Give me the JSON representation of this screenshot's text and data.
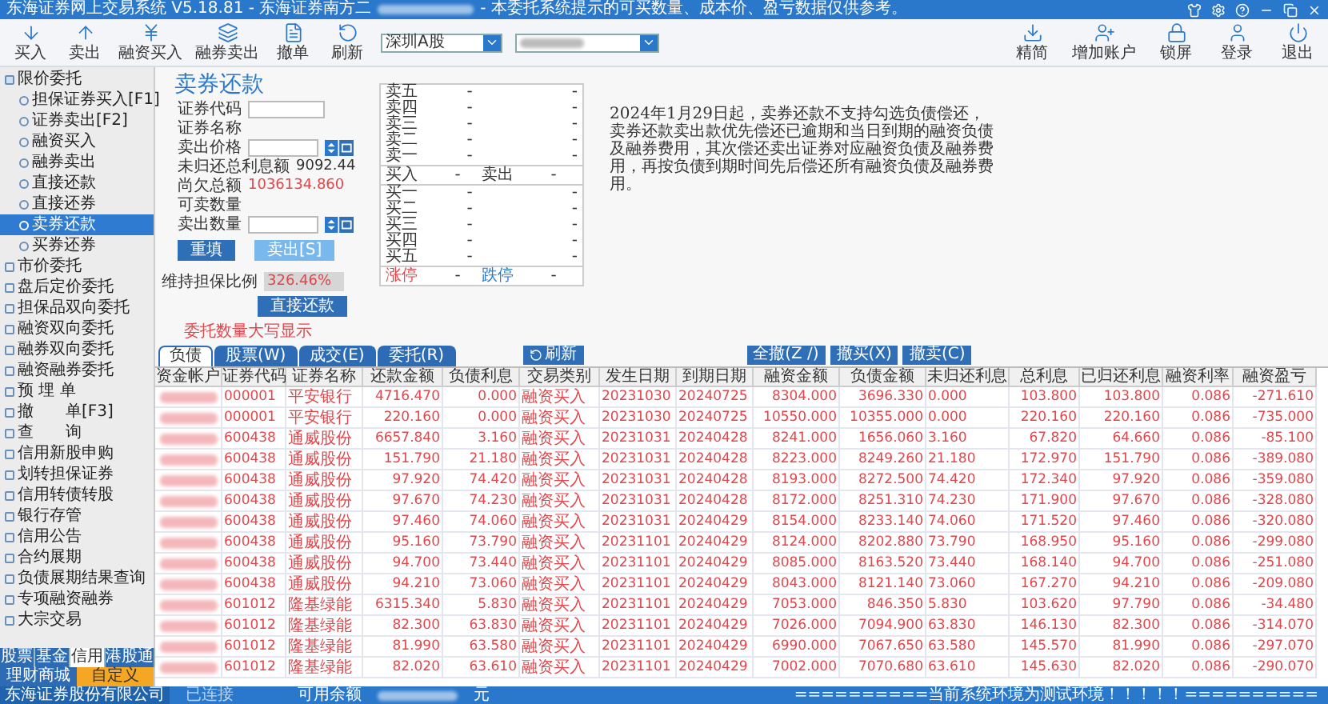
{
  "window": {
    "title": "东海证券网上交易系统 V5.18.81 - 东海证券南方二",
    "notice": " - 本委托系统提示的可买数量、成本价、盈亏数据仅供参考。"
  },
  "toolbar": {
    "buttons": [
      {
        "label": "买入",
        "kind": "buy"
      },
      {
        "label": "卖出",
        "kind": "sell"
      },
      {
        "label": "融资买入",
        "kind": "margin-buy"
      },
      {
        "label": "融券卖出",
        "kind": "short-sell"
      },
      {
        "label": "撤单",
        "kind": "cancel"
      },
      {
        "label": "刷新",
        "kind": "refresh"
      }
    ],
    "market_select": "深圳A股",
    "right_buttons": [
      {
        "label": "精简",
        "kind": "compact"
      },
      {
        "label": "增加账户",
        "kind": "add-account"
      },
      {
        "label": "锁屏",
        "kind": "lock"
      },
      {
        "label": "登录",
        "kind": "login"
      },
      {
        "label": "退出",
        "kind": "exit"
      }
    ]
  },
  "sidebar": {
    "items": [
      {
        "label": "限价委托",
        "selected": false,
        "expanded": true,
        "children": [
          {
            "label": "担保证券买入[F1]",
            "selected": false
          },
          {
            "label": "证券卖出[F2]",
            "selected": false
          },
          {
            "label": "融资买入",
            "selected": false
          },
          {
            "label": "融券卖出",
            "selected": false
          },
          {
            "label": "直接还款",
            "selected": false
          },
          {
            "label": "直接还券",
            "selected": false
          },
          {
            "label": "卖券还款",
            "selected": true
          },
          {
            "label": "买券还券",
            "selected": false
          }
        ]
      },
      {
        "label": "市价委托",
        "selected": false
      },
      {
        "label": "盘后定价委托",
        "selected": false
      },
      {
        "label": "担保品双向委托",
        "selected": false
      },
      {
        "label": "融资双向委托",
        "selected": false
      },
      {
        "label": "融券双向委托",
        "selected": false
      },
      {
        "label": "融资融券委托",
        "selected": false
      },
      {
        "label": "预 埋 单",
        "selected": false
      },
      {
        "label": "撤　　单[F3]",
        "selected": false
      },
      {
        "label": "查　　询",
        "selected": false
      },
      {
        "label": "信用新股申购",
        "selected": false
      },
      {
        "label": "划转担保证券",
        "selected": false
      },
      {
        "label": "信用转债转股",
        "selected": false
      },
      {
        "label": "银行存管",
        "selected": false
      },
      {
        "label": "信用公告",
        "selected": false
      },
      {
        "label": "合约展期",
        "selected": false
      },
      {
        "label": "负债展期结果查询",
        "selected": false
      },
      {
        "label": "专项融资融券",
        "selected": false
      },
      {
        "label": "大宗交易",
        "selected": false
      }
    ],
    "tabs": [
      {
        "label": "股票",
        "selected": false
      },
      {
        "label": "基金",
        "selected": false
      },
      {
        "label": "信用",
        "selected": true
      },
      {
        "label": "港股通",
        "selected": false
      }
    ],
    "links": [
      {
        "label": "理财商城",
        "selected": false
      },
      {
        "label": "自定义",
        "selected": true
      }
    ]
  },
  "form": {
    "title": "卖券还款",
    "fields": [
      {
        "label": "证券代码",
        "kind": "input"
      },
      {
        "label": "证券名称",
        "kind": "text"
      },
      {
        "label": "卖出价格",
        "kind": "spinner"
      },
      {
        "label": "未归还总利息额",
        "kind": "text",
        "value": "9092.44"
      },
      {
        "label": "尚欠总额",
        "kind": "alert",
        "value": "1036134.860"
      },
      {
        "label": "可卖数量",
        "kind": "text"
      },
      {
        "label": "卖出数量",
        "kind": "spinner"
      }
    ],
    "buttons": [
      {
        "label": "重填",
        "disabled": false
      },
      {
        "label": "卖出[S]",
        "disabled": true
      }
    ],
    "ratio_label": "维持担保比例",
    "ratio_value": "326.46%",
    "repay_button": "直接还款",
    "hint": "委托数量大写显示"
  },
  "order_book": {
    "asks": [
      {
        "label": "卖五",
        "price": "-",
        "volume": "-"
      },
      {
        "label": "卖四",
        "price": "-",
        "volume": "-"
      },
      {
        "label": "卖三",
        "price": "-",
        "volume": "-"
      },
      {
        "label": "卖二",
        "price": "-",
        "volume": "-"
      },
      {
        "label": "卖一",
        "price": "-",
        "volume": "-"
      }
    ],
    "middle": [
      {
        "label": "买入",
        "value": "-"
      },
      {
        "label": "卖出",
        "value": "-"
      }
    ],
    "bids": [
      {
        "label": "买一",
        "price": "-",
        "volume": "-"
      },
      {
        "label": "买二",
        "price": "-",
        "volume": "-"
      },
      {
        "label": "买三",
        "price": "-",
        "volume": "-"
      },
      {
        "label": "买四",
        "price": "-",
        "volume": "-"
      },
      {
        "label": "买五",
        "price": "-",
        "volume": "-"
      }
    ],
    "limits": [
      {
        "label": "涨停",
        "value": "-",
        "kind": "up"
      },
      {
        "label": "跌停",
        "value": "-",
        "kind": "down"
      }
    ]
  },
  "notice": "2024年1月29日起，卖券还款不支持勾选负债偿还，卖券还款卖出款优先偿还已逾期和当日到期的融资负债及融券费用，其次偿还卖出证券对应融资负债及融券费用，再按负债到期时间先后偿还所有融资负债及融券费用。",
  "positions": {
    "tabs": [
      {
        "label": "负债",
        "selected": true
      },
      {
        "label": "股票(W)",
        "selected": false
      },
      {
        "label": "成交(E)",
        "selected": false
      },
      {
        "label": "委托(R)",
        "selected": false
      }
    ],
    "refresh_button": "刷新",
    "buttons": [
      "全撤(Z /)",
      "撤买(X)",
      "撤卖(C)"
    ],
    "columns": [
      "资金帐户",
      "证券代码",
      "证券名称",
      "还款金额",
      "负债利息",
      "交易类别",
      "发生日期",
      "到期日期",
      "融资金额",
      "负债金额",
      "未归还利息",
      "总利息",
      "已归还利息",
      "融资利率",
      "融资盈亏"
    ],
    "rows": [
      [
        "",
        "000001",
        "平安银行",
        "4716.470",
        "0.000",
        "融资买入",
        "20231030",
        "20240725",
        "8304.000",
        "3696.330",
        "0.000",
        "103.800",
        "103.800",
        "0.086",
        "-271.610"
      ],
      [
        "",
        "000001",
        "平安银行",
        "220.160",
        "0.000",
        "融资买入",
        "20231030",
        "20240725",
        "10550.000",
        "10355.000",
        "0.000",
        "220.160",
        "220.160",
        "0.086",
        "-735.000"
      ],
      [
        "",
        "600438",
        "通威股份",
        "6657.840",
        "3.160",
        "融资买入",
        "20231031",
        "20240428",
        "8241.000",
        "1656.060",
        "3.160",
        "67.820",
        "64.660",
        "0.086",
        "-85.100"
      ],
      [
        "",
        "600438",
        "通威股份",
        "151.790",
        "21.180",
        "融资买入",
        "20231031",
        "20240428",
        "8223.000",
        "8249.260",
        "21.180",
        "172.970",
        "151.790",
        "0.086",
        "-389.080"
      ],
      [
        "",
        "600438",
        "通威股份",
        "97.920",
        "74.420",
        "融资买入",
        "20231031",
        "20240428",
        "8193.000",
        "8272.500",
        "74.420",
        "172.340",
        "97.920",
        "0.086",
        "-359.080"
      ],
      [
        "",
        "600438",
        "通威股份",
        "97.670",
        "74.230",
        "融资买入",
        "20231031",
        "20240428",
        "8172.000",
        "8251.310",
        "74.230",
        "171.900",
        "97.670",
        "0.086",
        "-328.080"
      ],
      [
        "",
        "600438",
        "通威股份",
        "97.460",
        "74.060",
        "融资买入",
        "20231031",
        "20240429",
        "8154.000",
        "8233.140",
        "74.060",
        "171.520",
        "97.460",
        "0.086",
        "-320.080"
      ],
      [
        "",
        "600438",
        "通威股份",
        "95.160",
        "73.790",
        "融资买入",
        "20231101",
        "20240429",
        "8124.000",
        "8202.880",
        "73.790",
        "168.950",
        "95.160",
        "0.086",
        "-299.080"
      ],
      [
        "",
        "600438",
        "通威股份",
        "94.700",
        "73.440",
        "融资买入",
        "20231101",
        "20240429",
        "8085.000",
        "8163.520",
        "73.440",
        "168.140",
        "94.700",
        "0.086",
        "-251.080"
      ],
      [
        "",
        "600438",
        "通威股份",
        "94.210",
        "73.060",
        "融资买入",
        "20231101",
        "20240429",
        "8043.000",
        "8121.140",
        "73.060",
        "167.270",
        "94.210",
        "0.086",
        "-209.080"
      ],
      [
        "",
        "601012",
        "隆基绿能",
        "6315.340",
        "5.830",
        "融资买入",
        "20231101",
        "20240429",
        "7053.000",
        "846.350",
        "5.830",
        "103.620",
        "97.790",
        "0.086",
        "-34.480"
      ],
      [
        "",
        "601012",
        "隆基绿能",
        "82.300",
        "63.830",
        "融资买入",
        "20231101",
        "20240429",
        "7026.000",
        "7094.900",
        "63.830",
        "146.130",
        "82.300",
        "0.086",
        "-314.070"
      ],
      [
        "",
        "601012",
        "隆基绿能",
        "81.990",
        "63.580",
        "融资买入",
        "20231101",
        "20240429",
        "6990.000",
        "7067.650",
        "63.580",
        "145.570",
        "81.990",
        "0.086",
        "-297.070"
      ],
      [
        "",
        "601012",
        "隆基绿能",
        "82.020",
        "63.610",
        "融资买入",
        "20231101",
        "20240429",
        "7002.000",
        "7070.680",
        "63.610",
        "145.630",
        "82.020",
        "0.086",
        "-290.070"
      ]
    ]
  },
  "status_bar": {
    "company": "东海证券股份有限公司",
    "connection": "已连接",
    "balance_label": "可用余额",
    "balance_unit": "元",
    "message": "==========当前系统环境为测试环境！！！！！=========="
  }
}
